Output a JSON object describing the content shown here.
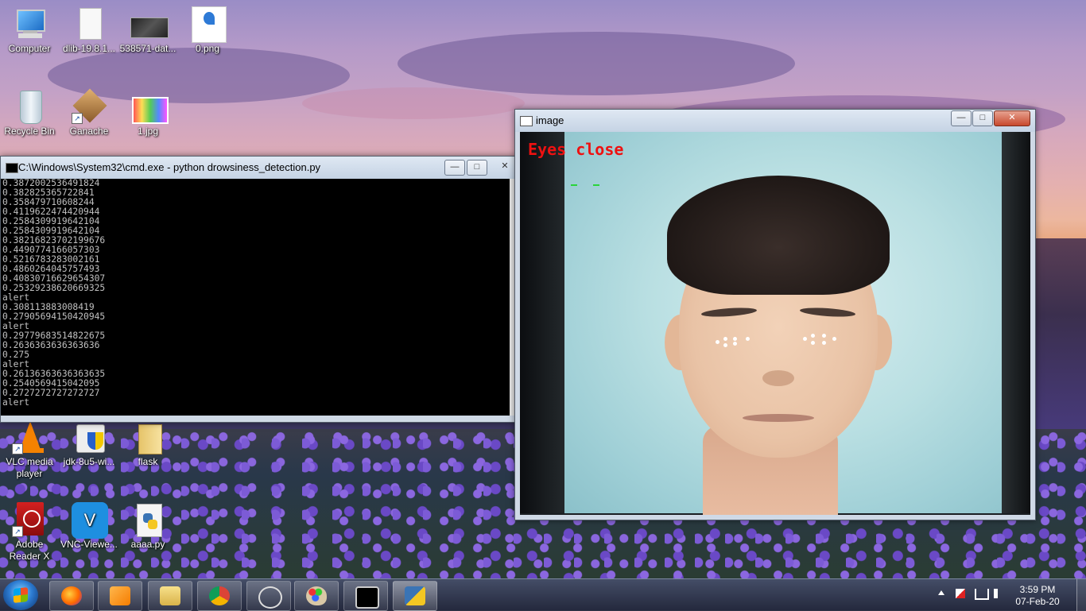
{
  "desktop": {
    "icons": [
      {
        "label": "Computer"
      },
      {
        "label": "dlib-19.8.1..."
      },
      {
        "label": "538571-dat..."
      },
      {
        "label": "0.png"
      },
      {
        "label": "Recycle Bin"
      },
      {
        "label": "Ganache"
      },
      {
        "label": "1.jpg"
      },
      {
        "label": "VLC media player"
      },
      {
        "label": "jdk-8u5-wi..."
      },
      {
        "label": "flask"
      },
      {
        "label": "Adobe Reader X"
      },
      {
        "label": "VNC-Viewe..."
      },
      {
        "label": "aaaa.py"
      }
    ]
  },
  "cmd_window": {
    "title": "C:\\Windows\\System32\\cmd.exe - python  drowsiness_detection.py",
    "lines": [
      "0.3872002536491824",
      "0.382825365722841",
      "0.358479710608244",
      "0.4119622474420944",
      "0.2584309919642104",
      "0.2584309919642104",
      "0.38216823702199676",
      "0.4490774166057303",
      "0.5216783283002161",
      "0.4860264045757493",
      "0.40830716629654307",
      "0.25329238620669325",
      "alert",
      "0.308113883008419",
      "0.27905694150420945",
      "alert",
      "0.29779683514822675",
      "0.2636363636363636",
      "0.275",
      "alert",
      "0.26136363636363635",
      "0.2540569415042095",
      "0.2727272727272727",
      "alert"
    ]
  },
  "image_window": {
    "title": "image",
    "status_text": "Eyes close"
  },
  "window_controls": {
    "minimize": "—",
    "maximize": "□",
    "close": "✕"
  },
  "taskbar": {
    "apps": [
      "firefox-icon",
      "vlc-taskbar-icon",
      "explorer-icon",
      "chrome-icon",
      "spider-app-icon",
      "paint-icon",
      "cmd-icon",
      "python-icon"
    ],
    "clock_time": "3:59 PM",
    "clock_date": "07-Feb-20"
  }
}
